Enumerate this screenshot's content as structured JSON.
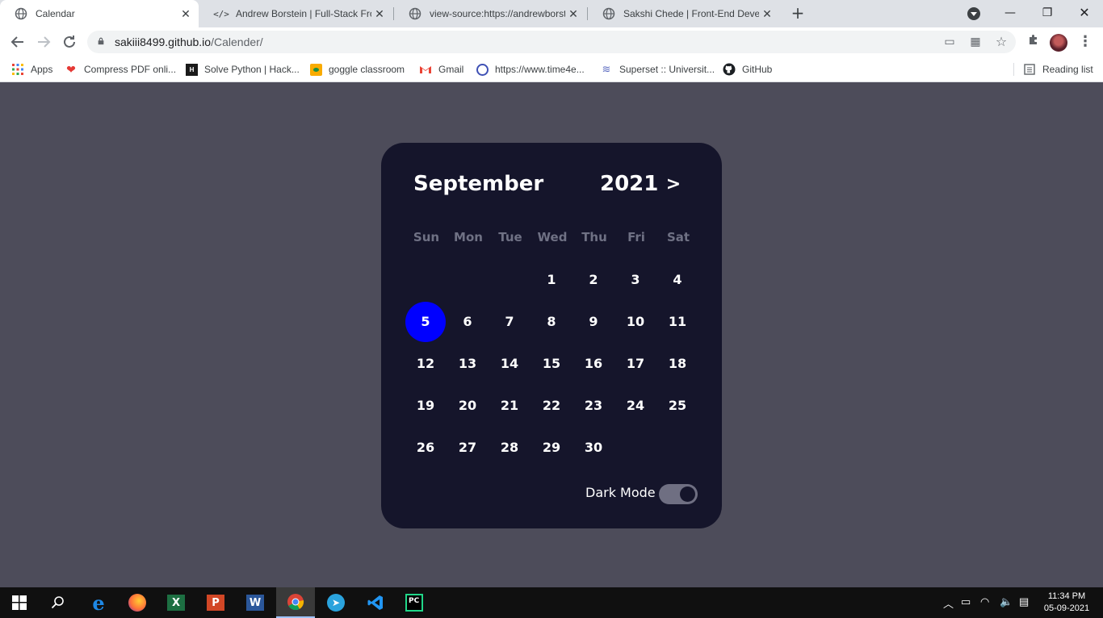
{
  "browser": {
    "tabs": [
      {
        "title": "Calendar",
        "active": true
      },
      {
        "title": "Andrew Borstein | Full-Stack Fron",
        "active": false
      },
      {
        "title": "view-source:https://andrewborste",
        "active": false
      },
      {
        "title": "Sakshi Chede | Front-End Develo",
        "active": false
      }
    ],
    "url_host": "sakiii8499.github.io",
    "url_path": "/Calender/",
    "bookmarks": [
      "Apps",
      "Compress PDF onli...",
      "Solve Python | Hack...",
      "goggle classroom",
      "Gmail",
      "https://www.time4e...",
      "Superset :: Universit...",
      "GitHub"
    ],
    "reading_list": "Reading list"
  },
  "calendar": {
    "month": "September",
    "year": "2021",
    "next_symbol": ">",
    "weekdays": [
      "Sun",
      "Mon",
      "Tue",
      "Wed",
      "Thu",
      "Fri",
      "Sat"
    ],
    "first_weekday": 3,
    "days_in_month": 30,
    "today": 5,
    "today_color": "#0000ff",
    "dark_mode_label": "Dark Mode",
    "dark_mode_on": true
  },
  "taskbar": {
    "time": "11:34 PM",
    "date": "05-09-2021"
  }
}
